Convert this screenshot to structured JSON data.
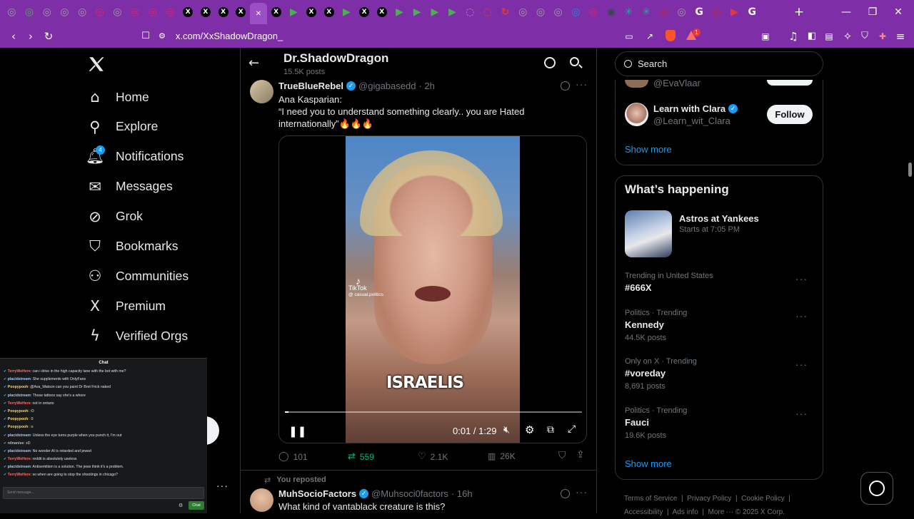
{
  "browser": {
    "tabs": [
      {
        "icon": "chrome-ext-icon",
        "color": "#9e9e9e",
        "glyph": "◎"
      },
      {
        "icon": "green-circle-icon",
        "color": "#4caf50",
        "glyph": "◎"
      },
      {
        "icon": "gray-circle-icon",
        "color": "#9e9e9e",
        "glyph": "◎"
      },
      {
        "icon": "gray-circle-icon",
        "color": "#9e9e9e",
        "glyph": "◎"
      },
      {
        "icon": "gray-circle-icon",
        "color": "#9e9e9e",
        "glyph": "◎"
      },
      {
        "icon": "red-circle-icon",
        "color": "#e91e63",
        "glyph": "◎"
      },
      {
        "icon": "gray-circle-icon",
        "color": "#9e9e9e",
        "glyph": "◎"
      },
      {
        "icon": "red-circle-icon",
        "color": "#e91e63",
        "glyph": "◎"
      },
      {
        "icon": "red-circle-icon",
        "color": "#e91e63",
        "glyph": "◎"
      },
      {
        "icon": "red-circle-icon",
        "color": "#e91e63",
        "glyph": "◎"
      },
      {
        "icon": "x-logo-icon",
        "color": "#000000",
        "glyph": "X"
      },
      {
        "icon": "x-logo-icon",
        "color": "#000000",
        "glyph": "X"
      },
      {
        "icon": "x-logo-icon",
        "color": "#000000",
        "glyph": "X"
      },
      {
        "icon": "x-logo-icon",
        "color": "#000000",
        "glyph": "X"
      },
      {
        "icon": "close-icon",
        "color": "#9a4fc4",
        "glyph": "✕",
        "active": true
      },
      {
        "icon": "x-logo-icon",
        "color": "#000000",
        "glyph": "X"
      },
      {
        "icon": "play-green-icon",
        "color": "#4caf50",
        "glyph": "▶"
      },
      {
        "icon": "x-logo-icon",
        "color": "#000000",
        "glyph": "X"
      },
      {
        "icon": "x-logo-icon",
        "color": "#000000",
        "glyph": "X"
      },
      {
        "icon": "play-green-icon",
        "color": "#4caf50",
        "glyph": "▶"
      },
      {
        "icon": "x-logo-icon",
        "color": "#000000",
        "glyph": "X"
      },
      {
        "icon": "x-logo-icon",
        "color": "#000000",
        "glyph": "X"
      },
      {
        "icon": "play-green-icon",
        "color": "#4caf50",
        "glyph": "▶"
      },
      {
        "icon": "play-green-icon",
        "color": "#4caf50",
        "glyph": "▶"
      },
      {
        "icon": "play-green-icon",
        "color": "#4caf50",
        "glyph": "▶"
      },
      {
        "icon": "play-green-icon",
        "color": "#4caf50",
        "glyph": "▶"
      },
      {
        "icon": "loading-icon",
        "color": "#9e9e9e",
        "glyph": "◌"
      },
      {
        "icon": "loading-red-icon",
        "color": "#e53935",
        "glyph": "◌"
      },
      {
        "icon": "refresh-red-icon",
        "color": "#e53935",
        "glyph": "↻"
      },
      {
        "icon": "gray-circle-icon",
        "color": "#9e9e9e",
        "glyph": "◎"
      },
      {
        "icon": "gray-circle-icon",
        "color": "#9e9e9e",
        "glyph": "◎"
      },
      {
        "icon": "gray-circle-icon",
        "color": "#9e9e9e",
        "glyph": "◎"
      },
      {
        "icon": "blue-circle-icon",
        "color": "#1e88e5",
        "glyph": "◎"
      },
      {
        "icon": "red-circle-icon",
        "color": "#e91e63",
        "glyph": "◎"
      },
      {
        "icon": "dark-circle-icon",
        "color": "#37474f",
        "glyph": "◉"
      },
      {
        "icon": "teal-flower-icon",
        "color": "#26a69a",
        "glyph": "✳"
      },
      {
        "icon": "teal-flower-icon",
        "color": "#26a69a",
        "glyph": "✳"
      },
      {
        "icon": "red-circle-icon",
        "color": "#c62828",
        "glyph": "◎"
      },
      {
        "icon": "gray-circle-icon",
        "color": "#9e9e9e",
        "glyph": "◎"
      },
      {
        "icon": "google-icon",
        "color": "#ffffff",
        "glyph": "G"
      },
      {
        "icon": "red-circle-icon",
        "color": "#c62828",
        "glyph": "◎"
      },
      {
        "icon": "youtube-icon",
        "color": "#e53935",
        "glyph": "▶"
      },
      {
        "icon": "google-icon",
        "color": "#ffffff",
        "glyph": "G"
      }
    ],
    "url": "x.com/XxShadowDragon_",
    "notif_badge": "1"
  },
  "nav": {
    "items": [
      {
        "label": "Home",
        "icon": "home-icon"
      },
      {
        "label": "Explore",
        "icon": "search-icon"
      },
      {
        "label": "Notifications",
        "icon": "bell-icon",
        "badge": "4"
      },
      {
        "label": "Messages",
        "icon": "mail-icon"
      },
      {
        "label": "Grok",
        "icon": "grok-icon"
      },
      {
        "label": "Bookmarks",
        "icon": "bookmark-icon"
      },
      {
        "label": "Communities",
        "icon": "communities-icon"
      },
      {
        "label": "Premium",
        "icon": "x-premium-icon"
      },
      {
        "label": "Verified Orgs",
        "icon": "lightning-icon"
      }
    ]
  },
  "profile_header": {
    "name": "Dr.ShadowDragon",
    "posts": "15.5K posts"
  },
  "tweet": {
    "author": "TrueBlueRebel",
    "handle": "@gigabasedd",
    "time": "· 2h",
    "text_line1": "Ana Kasparian:",
    "text_line2": "“I need you to understand something clearly.. you are Hated",
    "text_line3": "internationally”🔥🔥🔥",
    "video": {
      "caption": "ISRAELIS",
      "tiktok": "TikTok",
      "tiktok_user": "@ casual.politics",
      "time": "0:01 / 1:29",
      "progress": 0.013
    },
    "replies": "101",
    "reposts": "559",
    "likes": "2.1K",
    "views": "26K"
  },
  "next_tweet": {
    "repost_label": "You reposted",
    "author": "MuhSocioFactors",
    "handle": "@Muhsoci0factors",
    "time": "· 16h",
    "text": "What kind of vantablack creature is this?"
  },
  "right": {
    "search_placeholder": "Search",
    "follow_partial_handle": "@EvaVlaar",
    "follow": {
      "name": "Learn with Clara",
      "handle": "@Learn_wit_Clara",
      "button": "Follow"
    },
    "show_more": "Show more",
    "happening_title": "What’s happening",
    "event": {
      "title": "Astros at Yankees",
      "time": "Starts at 7:05 PM"
    },
    "trends": [
      {
        "meta": "Trending in United States",
        "name": "#666X",
        "count": ""
      },
      {
        "meta": "Politics · Trending",
        "name": "Kennedy",
        "count": "44.5K posts"
      },
      {
        "meta": "Only on X · Trending",
        "name": "#voreday",
        "count": "8,691 posts"
      },
      {
        "meta": "Politics · Trending",
        "name": "Fauci",
        "count": "19.6K posts"
      }
    ],
    "show_more_2": "Show more",
    "footer": {
      "a": "Terms of Service",
      "b": "Privacy Policy",
      "c": "Cookie Policy",
      "d": "Accessibility",
      "e": "Ads info",
      "f": "More ···",
      "g": "© 2025 X Corp."
    }
  },
  "chat": {
    "title": "Chat",
    "messages": [
      {
        "user": "TerryWeHere",
        "color": "#ff6b6b",
        "text": "can i drive in the high capacity lane with the bot with me?"
      },
      {
        "user": "placidstream",
        "color": "#9ec9ff",
        "text": "She supplements with OnlyFans"
      },
      {
        "user": "Poopypooh",
        "color": "#ffd54f",
        "text": "@Ava_Watson can you paint Dr Bret Frick naked"
      },
      {
        "user": "placidstream",
        "color": "#9ec9ff",
        "text": "Those tattoos say she's a whore"
      },
      {
        "user": "TerryWeHere",
        "color": "#ff6b6b",
        "text": "not in ontario"
      },
      {
        "user": "Poopypooh",
        "color": "#ffd54f",
        "text": ":O"
      },
      {
        "user": "Poopypooh",
        "color": "#ffd54f",
        "text": ":0"
      },
      {
        "user": "Poopypooh",
        "color": "#ffd54f",
        "text": ":o"
      },
      {
        "user": "placidstream",
        "color": "#9ec9ff",
        "text": "Unless the eye turns purple when you punch it, I'm out"
      },
      {
        "user": "nilnanise",
        "color": "#b0bec5",
        "text": "xD"
      },
      {
        "user": "placidstream",
        "color": "#9ec9ff",
        "text": "No wonder AI is retarded and jewed"
      },
      {
        "user": "TerryWeHere",
        "color": "#ff6b6b",
        "text": "reddit is absolutely useless"
      },
      {
        "user": "placidstream",
        "color": "#9ec9ff",
        "text": "Antisemitism is a solution. The jews think it's a problem."
      },
      {
        "user": "TerryWeHere",
        "color": "#ff6b6b",
        "text": "so when are going to stop the shootings in chicago?"
      }
    ],
    "input_placeholder": "Send message...",
    "send": "Chat"
  }
}
